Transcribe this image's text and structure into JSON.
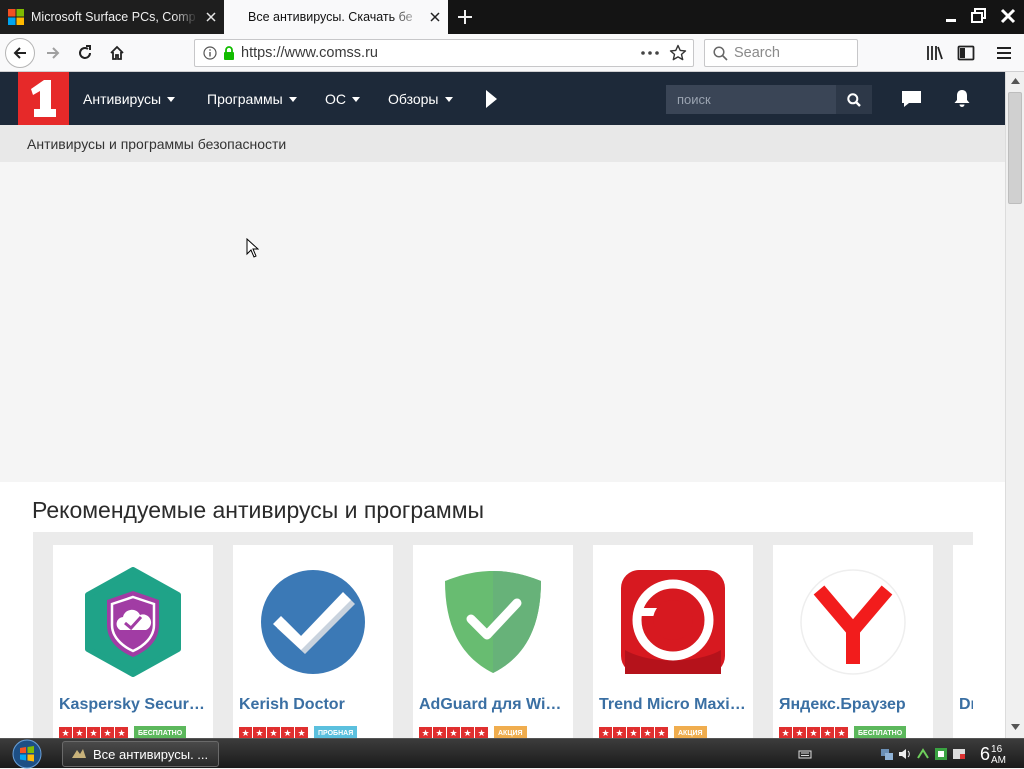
{
  "browser": {
    "tabs": [
      {
        "title": "Microsoft Surface PCs, Comp",
        "active": false
      },
      {
        "title": "Все антивирусы. Скачать бе",
        "active": true
      }
    ],
    "url": "https://www.comss.ru",
    "search_placeholder": "Search"
  },
  "site": {
    "menu": [
      "Антивирусы",
      "Программы",
      "ОС",
      "Обзоры"
    ],
    "search_placeholder": "поиск",
    "breadcrumb": "Антивирусы и программы безопасности",
    "accent_color": "#e62929",
    "header_color": "#1d2939"
  },
  "recommended": {
    "title": "Рекомендуемые антивирусы и программы",
    "cards": [
      {
        "name": "Kaspersky Security Cloud",
        "badge": "бесплатно",
        "badge_color": "#5cb85c",
        "icon": "kaspersky-cloud-icon"
      },
      {
        "name": "Kerish Doctor",
        "badge": "пробная",
        "badge_color": "#5bc0de",
        "icon": "kerish-doctor-icon"
      },
      {
        "name": "AdGuard для Windows",
        "badge": "акция",
        "badge_color": "#f0ad4e",
        "icon": "adguard-icon"
      },
      {
        "name": "Trend Micro Maximum Security",
        "badge": "акция",
        "badge_color": "#f0ad4e",
        "icon": "trend-micro-icon"
      },
      {
        "name": "Яндекс.Браузер",
        "badge": "бесплатно",
        "badge_color": "#5cb85c",
        "icon": "yandex-browser-icon"
      },
      {
        "name": "Dr",
        "badge": "",
        "badge_color": "#5cb85c",
        "icon": ""
      }
    ]
  },
  "taskbar": {
    "task_label": "Все антивирусы. ...",
    "clock_hour": "6",
    "clock_minute": "16",
    "clock_ampm": "AM"
  }
}
